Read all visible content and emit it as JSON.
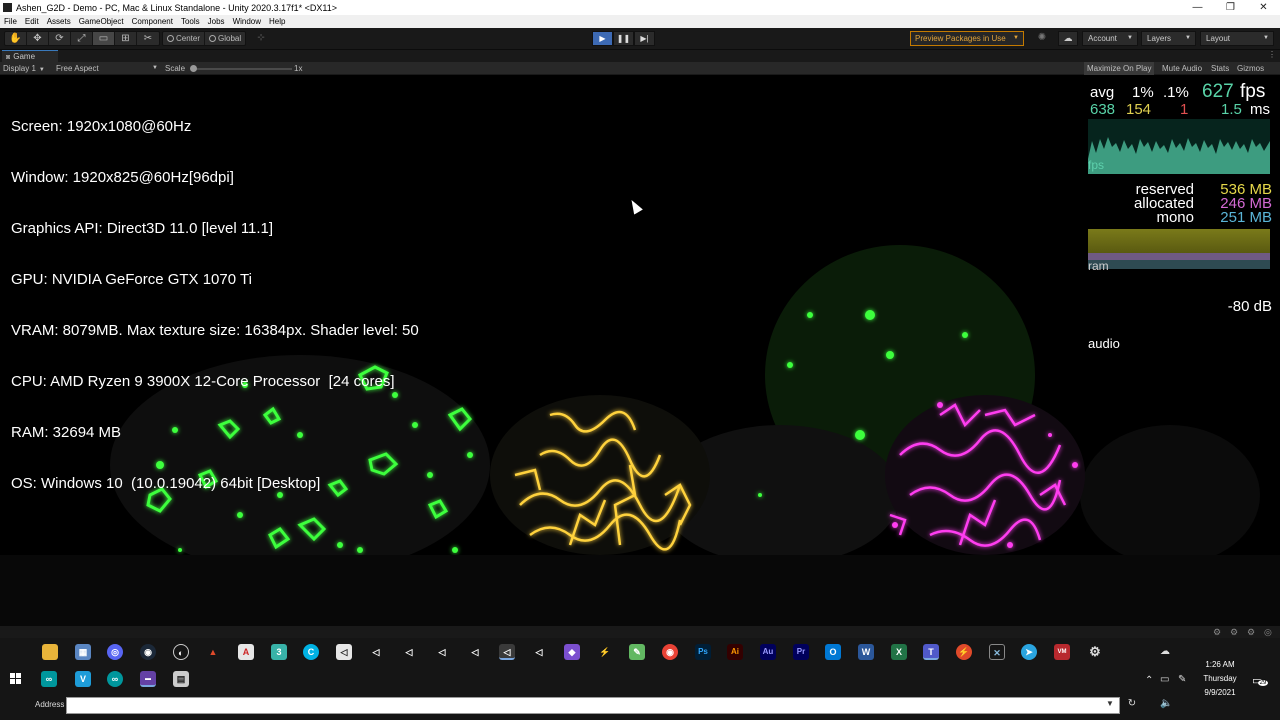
{
  "window": {
    "title": "Ashen_G2D - Demo - PC, Mac & Linux Standalone - Unity 2020.3.17f1* <DX11>",
    "minimize": "—",
    "restore": "❐",
    "close": "✕"
  },
  "menu": [
    "File",
    "Edit",
    "Assets",
    "GameObject",
    "Component",
    "Tools",
    "Jobs",
    "Window",
    "Help"
  ],
  "toolbar": {
    "tools": [
      "✋",
      "✥",
      "⟳",
      "⤢",
      "▭",
      "⊞",
      "✂"
    ],
    "pivot_label": "Center",
    "space_label": "Global",
    "play": "▶",
    "pause": "❚❚",
    "step": "▶|",
    "preview_packages": "Preview Packages in Use",
    "account": "Account",
    "layers": "Layers",
    "layout": "Layout",
    "accent_color": "#3d6ab4"
  },
  "game_tab": {
    "label": "Game"
  },
  "game_bar": {
    "display": "Display 1",
    "aspect": "Free Aspect",
    "scale_label": "Scale",
    "scale_value": "1x",
    "maximize": "Maximize On Play",
    "mute": "Mute Audio",
    "stats": "Stats",
    "gizmos": "Gizmos"
  },
  "sysinfo": [
    "Screen: 1920x1080@60Hz",
    "Window: 1920x825@60Hz[96dpi]",
    "Graphics API: Direct3D 11.0 [level 11.1]",
    "GPU: NVIDIA GeForce GTX 1070 Ti",
    "VRAM: 8079MB. Max texture size: 16384px. Shader level: 50",
    "CPU: AMD Ryzen 9 3900X 12-Core Processor  [24 cores]",
    "RAM: 32694 MB",
    "OS: Windows 10  (10.0.19042) 64bit [Desktop]"
  ],
  "fps": {
    "avg_label": "avg",
    "p1_label": "1%",
    "p01_label": ".1%",
    "fps_value": "627",
    "fps_unit": "fps",
    "avg": "638",
    "p1": "154",
    "p01": "1",
    "ms": "1.5",
    "ms_unit": "ms",
    "graph_label": "fps",
    "color": "#59d3a8"
  },
  "memory": {
    "reserved_label": "reserved",
    "reserved": "536 MB",
    "allocated_label": "allocated",
    "allocated": "246 MB",
    "mono_label": "mono",
    "mono": "251 MB",
    "ram_label": "ram"
  },
  "audio": {
    "db": "-80 dB",
    "label": "audio"
  },
  "taskbar": {
    "address_label": "Address",
    "address_value": "",
    "clock_time": "1:26 AM",
    "clock_day": "Thursday",
    "clock_date": "9/9/2021",
    "notifications": "29"
  }
}
